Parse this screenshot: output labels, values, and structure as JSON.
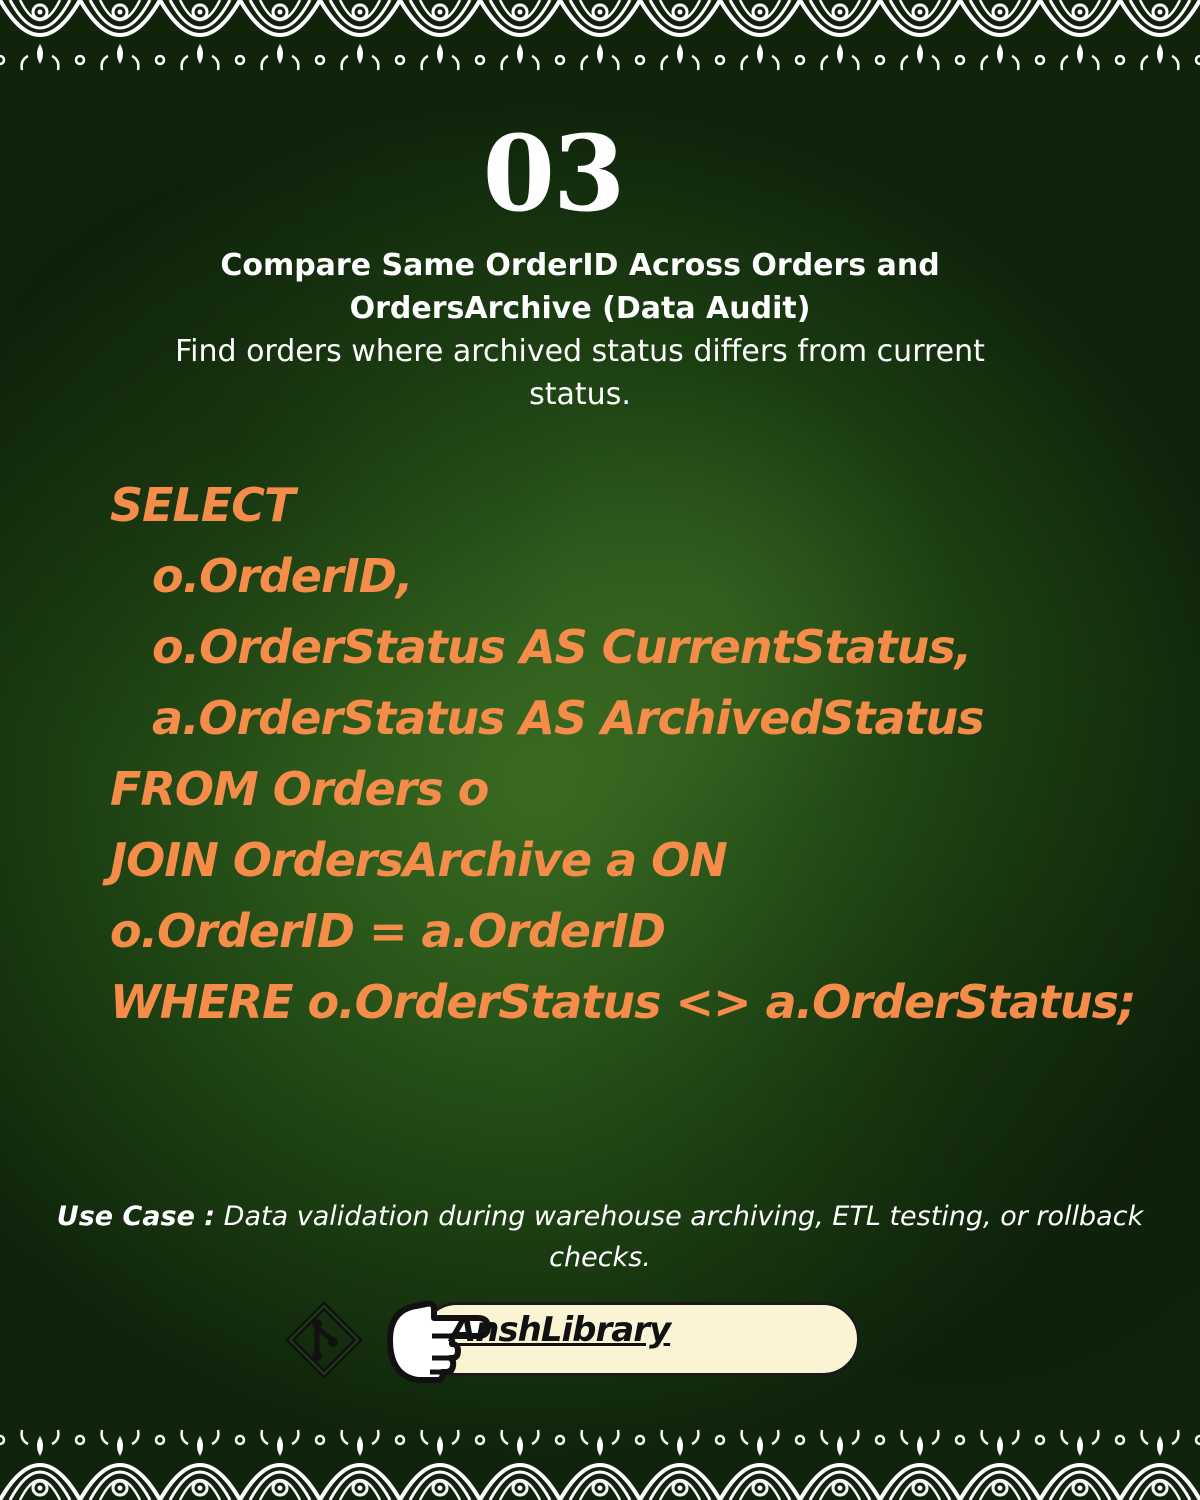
{
  "slide": {
    "number": "03",
    "title": "Compare Same OrderID Across Orders and OrdersArchive (Data Audit)",
    "subtitle": "Find orders where archived status differs from current status."
  },
  "code": {
    "lines": [
      "SELECT",
      "o.OrderID,",
      "o.OrderStatus AS CurrentStatus,",
      "a.OrderStatus AS ArchivedStatus",
      "FROM Orders o",
      "JOIN OrdersArchive a ON",
      "o.OrderID = a.OrderID",
      "WHERE o.OrderStatus <> a.OrderStatus;"
    ]
  },
  "use_case": {
    "label": "Use Case :",
    "text": " Data validation during warehouse archiving, ETL testing, or rollback checks."
  },
  "brand": {
    "name": "AnshLibrary",
    "icons": [
      "git-icon",
      "pointing-hand-icon"
    ]
  },
  "colors": {
    "background": "#1f4414",
    "code": "#f58c4a",
    "text": "#ffffff",
    "pill": "#fbf4d4"
  }
}
